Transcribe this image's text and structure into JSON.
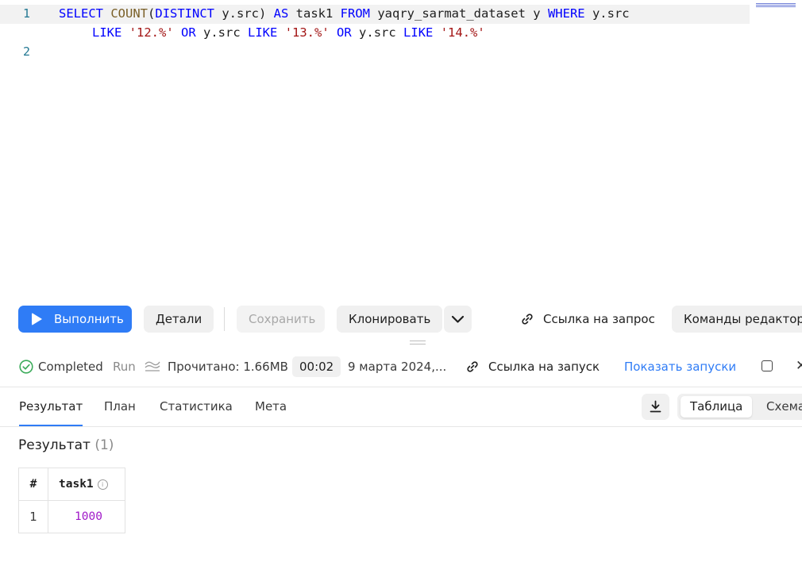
{
  "editor": {
    "line_numbers": [
      "1",
      "2"
    ],
    "line1": {
      "t1": "SELECT",
      "t2": "COUNT",
      "t3": "(",
      "t4": "DISTINCT",
      "t5": " y.src) ",
      "t6": "AS",
      "t7": " task1 ",
      "t8": "FROM",
      "t9": " yaqry_sarmat_dataset y ",
      "t10": "WHERE",
      "t11": " y.src"
    },
    "line1_wrap": {
      "t1": "LIKE",
      "t2": "'12.%'",
      "t3": "OR",
      "t4": " y.src ",
      "t5": "LIKE",
      "t6": "'13.%'",
      "t7": "OR",
      "t8": " y.src ",
      "t9": "LIKE",
      "t10": "'14.%'"
    }
  },
  "toolbar": {
    "run_label": "Выполнить",
    "details_label": "Детали",
    "save_label": "Сохранить",
    "clone_label": "Клонировать",
    "query_link_label": "Ссылка на запрос",
    "editor_commands_label": "Команды редактора"
  },
  "status": {
    "state": "Completed",
    "mode": "Run",
    "read_label": "Прочитано: 1.66MB",
    "duration": "00:02",
    "date": "9 марта 2024,...",
    "run_link_label": "Ссылка на запуск",
    "show_runs_label": "Показать запуски",
    "status_color": "#3bab5a",
    "link_color": "#2f7cf6"
  },
  "tabs": {
    "result": "Результат",
    "plan": "План",
    "stats": "Статистика",
    "meta": "Мета",
    "active": "result"
  },
  "view_toggle": {
    "table": "Таблица",
    "schema": "Схема",
    "selected": "table"
  },
  "result": {
    "title": "Результат",
    "count": "(1)",
    "columns": [
      "#",
      "task1"
    ],
    "rows": [
      {
        "index": "1",
        "task1": "1000"
      }
    ]
  },
  "colors": {
    "accent": "#2f7cf6",
    "value_purple": "#a018c8",
    "keyword_blue": "#0000ff",
    "string_red": "#a31515",
    "gutter_teal": "#237893"
  }
}
